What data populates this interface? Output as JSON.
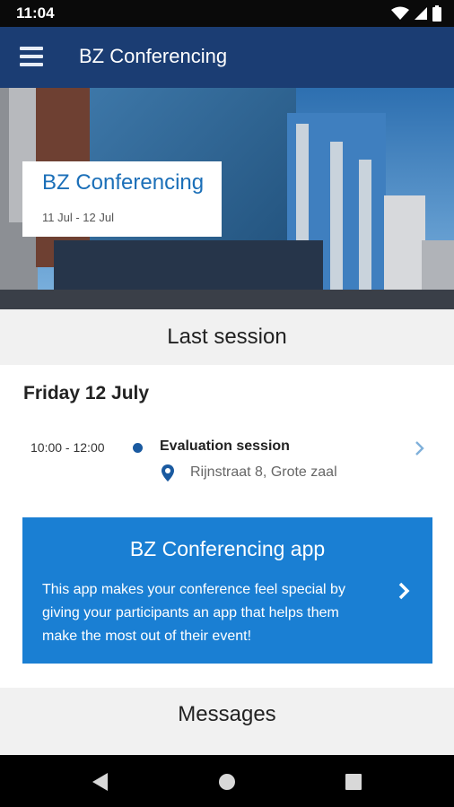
{
  "status_bar": {
    "time": "11:04"
  },
  "app_bar": {
    "title": "BZ Conferencing"
  },
  "hero": {
    "title": "BZ Conferencing",
    "dates": "11 Jul - 12 Jul"
  },
  "last_session": {
    "header": "Last session",
    "day": "Friday 12 July",
    "session": {
      "time": "10:00 - 12:00",
      "name": "Evaluation session",
      "location": "Rijnstraat 8, Grote zaal"
    }
  },
  "promo": {
    "title": "BZ Conferencing app",
    "text": "This app makes your conference feel special by giving your participants an app that helps them make the most out of their event!"
  },
  "messages": {
    "header": "Messages"
  },
  "colors": {
    "app_bar": "#1b3d73",
    "accent": "#1a7fd3",
    "dot": "#1a5aa0"
  }
}
